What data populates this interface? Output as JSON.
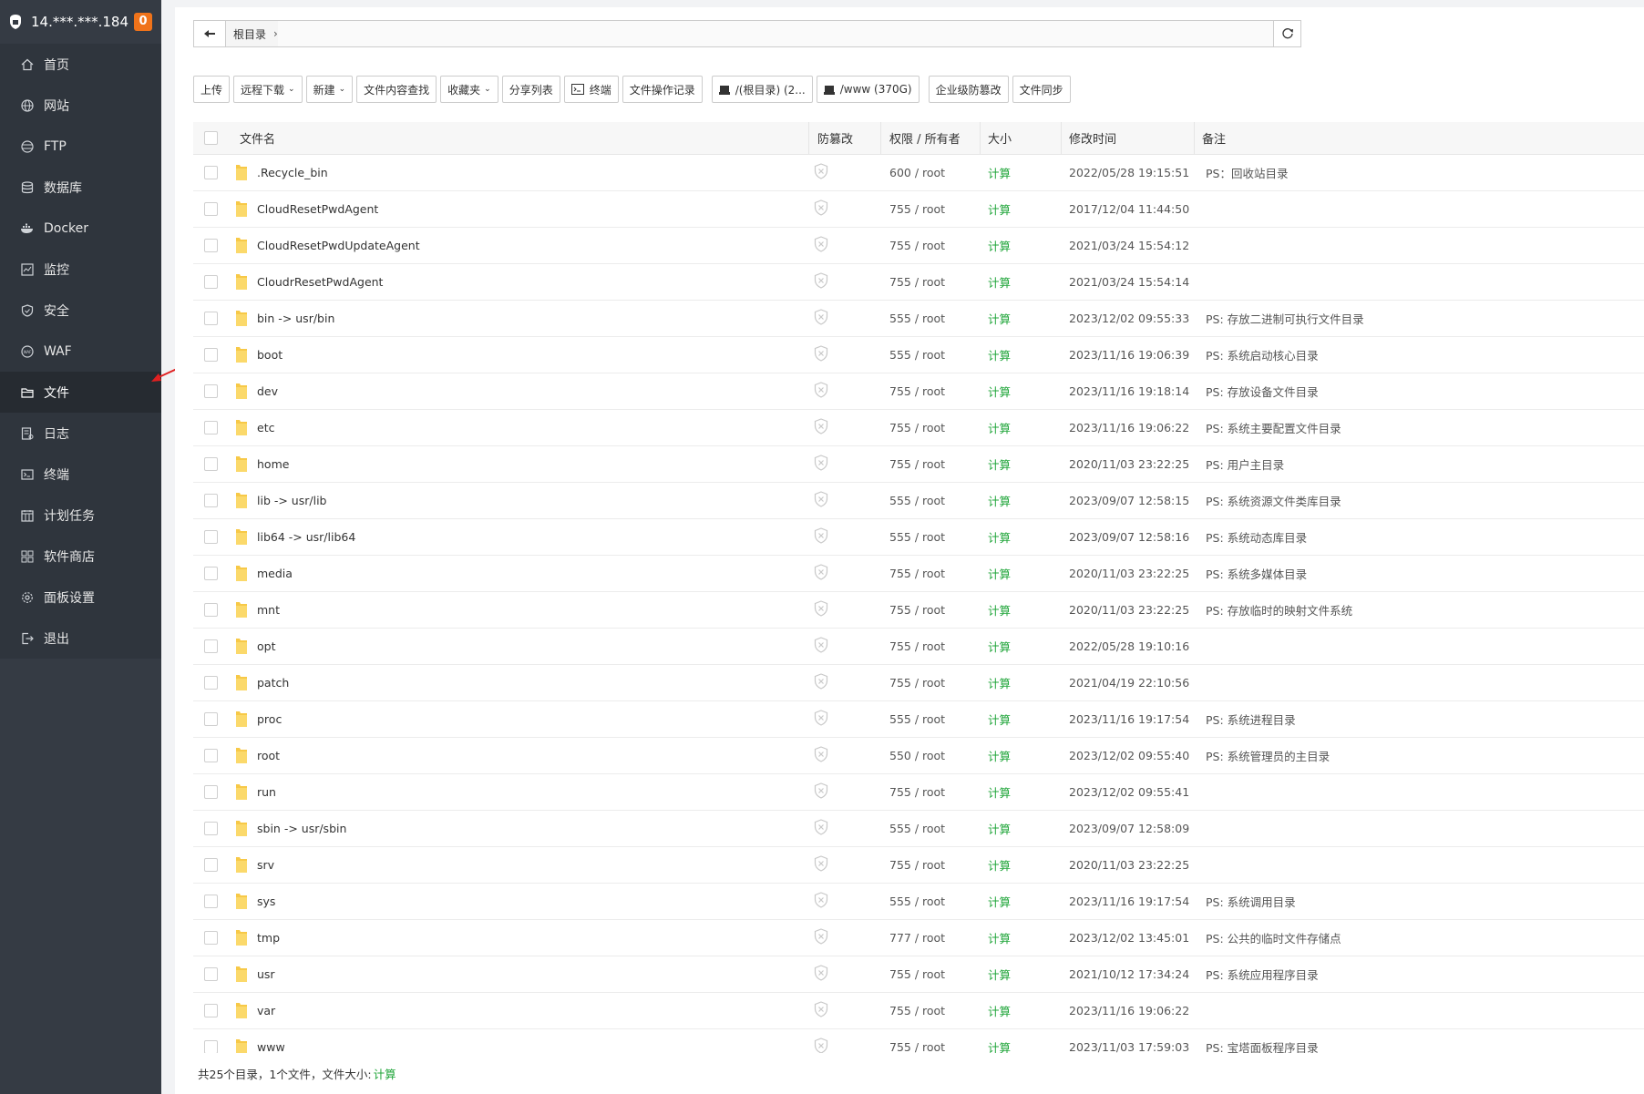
{
  "sidebar": {
    "server_ip": "14.***.***.184",
    "badge_count": "0",
    "items": [
      {
        "label": "首页",
        "icon": "home-icon"
      },
      {
        "label": "网站",
        "icon": "globe-icon"
      },
      {
        "label": "FTP",
        "icon": "ftp-icon"
      },
      {
        "label": "数据库",
        "icon": "database-icon"
      },
      {
        "label": "Docker",
        "icon": "docker-icon"
      },
      {
        "label": "监控",
        "icon": "monitor-icon"
      },
      {
        "label": "安全",
        "icon": "shield-icon"
      },
      {
        "label": "WAF",
        "icon": "waf-icon"
      },
      {
        "label": "文件",
        "icon": "folder-icon",
        "active": true
      },
      {
        "label": "日志",
        "icon": "log-icon"
      },
      {
        "label": "终端",
        "icon": "terminal-icon"
      },
      {
        "label": "计划任务",
        "icon": "calendar-icon"
      },
      {
        "label": "软件商店",
        "icon": "apps-icon"
      },
      {
        "label": "面板设置",
        "icon": "gear-icon"
      },
      {
        "label": "退出",
        "icon": "logout-icon"
      }
    ]
  },
  "pathbar": {
    "crumb": "根目录",
    "crumb_arrow": "›"
  },
  "toolbar": {
    "upload": "上传",
    "remote_download": "远程下载",
    "new": "新建",
    "content_search": "文件内容查找",
    "favorites": "收藏夹",
    "share_list": "分享列表",
    "terminal": "终端",
    "op_log": "文件操作记录",
    "disk_root": "/(根目录) (2...",
    "disk_www": "/www (370G)",
    "enterprise_tamper": "企业级防篡改",
    "file_sync": "文件同步"
  },
  "table": {
    "headers": {
      "name": "文件名",
      "tamper": "防篡改",
      "perm": "权限 / 所有者",
      "size": "大小",
      "mtime": "修改时间",
      "note": "备注"
    },
    "rows": [
      {
        "name": ".Recycle_bin",
        "perm": "600 / root",
        "size": "计算",
        "mtime": "2022/05/28 19:15:51",
        "note": "PS：回收站目录"
      },
      {
        "name": "CloudResetPwdAgent",
        "perm": "755 / root",
        "size": "计算",
        "mtime": "2017/12/04 11:44:50",
        "note": ""
      },
      {
        "name": "CloudResetPwdUpdateAgent",
        "perm": "755 / root",
        "size": "计算",
        "mtime": "2021/03/24 15:54:12",
        "note": ""
      },
      {
        "name": "CloudrResetPwdAgent",
        "perm": "755 / root",
        "size": "计算",
        "mtime": "2021/03/24 15:54:14",
        "note": ""
      },
      {
        "name": "bin -> usr/bin",
        "perm": "555 / root",
        "size": "计算",
        "mtime": "2023/12/02 09:55:33",
        "note": "PS: 存放二进制可执行文件目录"
      },
      {
        "name": "boot",
        "perm": "555 / root",
        "size": "计算",
        "mtime": "2023/11/16 19:06:39",
        "note": "PS: 系统启动核心目录"
      },
      {
        "name": "dev",
        "perm": "755 / root",
        "size": "计算",
        "mtime": "2023/11/16 19:18:14",
        "note": "PS: 存放设备文件目录"
      },
      {
        "name": "etc",
        "perm": "755 / root",
        "size": "计算",
        "mtime": "2023/11/16 19:06:22",
        "note": "PS: 系统主要配置文件目录"
      },
      {
        "name": "home",
        "perm": "755 / root",
        "size": "计算",
        "mtime": "2020/11/03 23:22:25",
        "note": "PS: 用户主目录"
      },
      {
        "name": "lib -> usr/lib",
        "perm": "555 / root",
        "size": "计算",
        "mtime": "2023/09/07 12:58:15",
        "note": "PS: 系统资源文件类库目录"
      },
      {
        "name": "lib64 -> usr/lib64",
        "perm": "555 / root",
        "size": "计算",
        "mtime": "2023/09/07 12:58:16",
        "note": "PS:  系统动态库目录"
      },
      {
        "name": "media",
        "perm": "755 / root",
        "size": "计算",
        "mtime": "2020/11/03 23:22:25",
        "note": "PS:  系统多媒体目录"
      },
      {
        "name": "mnt",
        "perm": "755 / root",
        "size": "计算",
        "mtime": "2020/11/03 23:22:25",
        "note": "PS: 存放临时的映射文件系统"
      },
      {
        "name": "opt",
        "perm": "755 / root",
        "size": "计算",
        "mtime": "2022/05/28 19:10:16",
        "note": ""
      },
      {
        "name": "patch",
        "perm": "755 / root",
        "size": "计算",
        "mtime": "2021/04/19 22:10:56",
        "note": ""
      },
      {
        "name": "proc",
        "perm": "555 / root",
        "size": "计算",
        "mtime": "2023/11/16 19:17:54",
        "note": "PS:  系统进程目录"
      },
      {
        "name": "root",
        "perm": "550 / root",
        "size": "计算",
        "mtime": "2023/12/02 09:55:40",
        "note": "PS: 系统管理员的主目录"
      },
      {
        "name": "run",
        "perm": "755 / root",
        "size": "计算",
        "mtime": "2023/12/02 09:55:41",
        "note": ""
      },
      {
        "name": "sbin -> usr/sbin",
        "perm": "555 / root",
        "size": "计算",
        "mtime": "2023/09/07 12:58:09",
        "note": ""
      },
      {
        "name": "srv",
        "perm": "755 / root",
        "size": "计算",
        "mtime": "2020/11/03 23:22:25",
        "note": ""
      },
      {
        "name": "sys",
        "perm": "555 / root",
        "size": "计算",
        "mtime": "2023/11/16 19:17:54",
        "note": "PS:  系统调用目录"
      },
      {
        "name": "tmp",
        "perm": "777 / root",
        "size": "计算",
        "mtime": "2023/12/02 13:45:01",
        "note": "PS: 公共的临时文件存储点"
      },
      {
        "name": "usr",
        "perm": "755 / root",
        "size": "计算",
        "mtime": "2021/10/12 17:34:24",
        "note": "PS: 系统应用程序目录"
      },
      {
        "name": "var",
        "perm": "755 / root",
        "size": "计算",
        "mtime": "2023/11/16 19:06:22",
        "note": ""
      },
      {
        "name": "www",
        "perm": "755 / root",
        "size": "计算",
        "mtime": "2023/11/03 17:59:03",
        "note": "PS: 宝塔面板程序目录"
      }
    ]
  },
  "footer": {
    "summary": "共25个目录，1个文件，文件大小:",
    "calc": "计算"
  },
  "colors": {
    "sidebar_bg": "#353b44",
    "accent_green": "#20a53a",
    "badge_orange": "#f0731a",
    "folder_yellow": "#f7c948",
    "arrow_red": "#e02020"
  }
}
